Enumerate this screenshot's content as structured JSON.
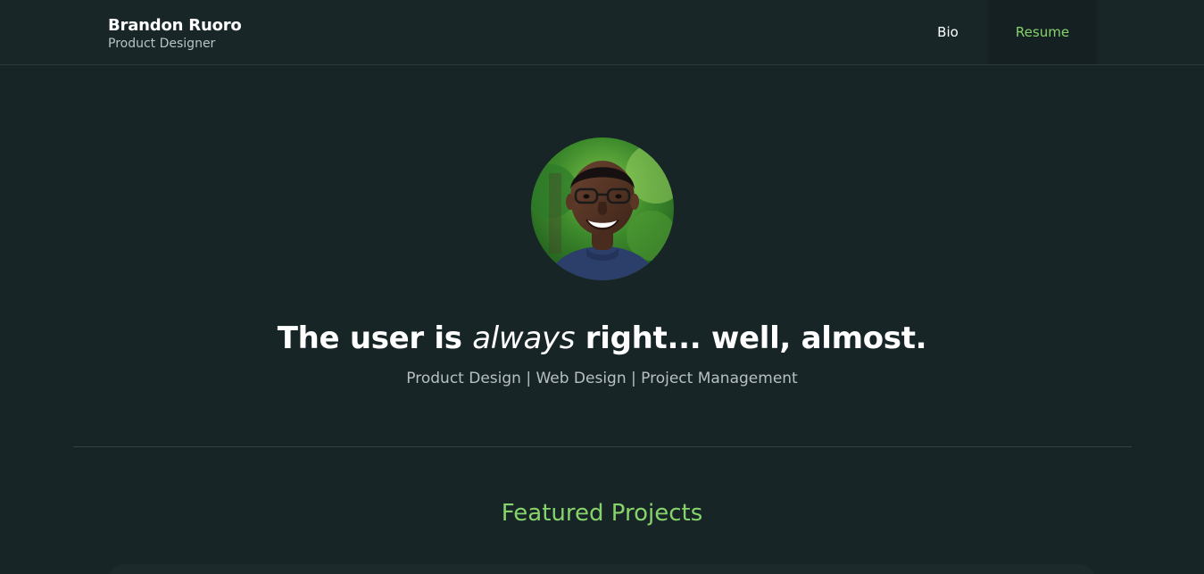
{
  "header": {
    "name": "Brandon Ruoro",
    "role": "Product Designer",
    "nav": [
      {
        "label": "Bio"
      },
      {
        "label": "Resume"
      }
    ],
    "active_nav": "Resume"
  },
  "hero": {
    "avatar_icon": "profile-photo",
    "headline_before": "The user is ",
    "headline_emphasis": "always",
    "headline_after": " right... well, almost.",
    "tagline": "Product Design | Web Design | Project Management"
  },
  "featured": {
    "title": "Featured Projects"
  },
  "colors": {
    "background": "#182527",
    "accent": "#86d36b",
    "text": "#ffffff",
    "muted": "#b6c0c1"
  }
}
